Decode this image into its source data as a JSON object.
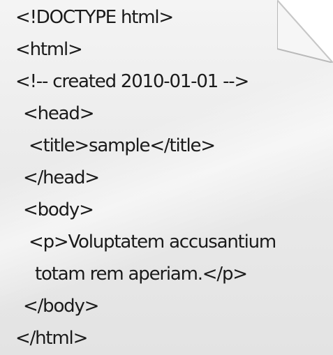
{
  "document": {
    "icon": "text-document-icon",
    "lines": [
      "<!DOCTYPE html>",
      "<html>",
      "<!-- created 2010-01-01 -->",
      "<head>",
      "<title>sample</title>",
      "</head>",
      "<body>",
      "<p>Voluptatem accusantium",
      "totam rem aperiam.</p>",
      "</body>",
      "</html>"
    ]
  },
  "colors": {
    "text": "#1a1a1a",
    "paper": "#eeeeee",
    "fold": "#f8f8f8"
  }
}
